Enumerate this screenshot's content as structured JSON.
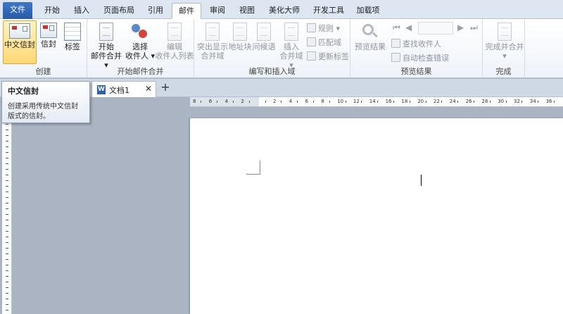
{
  "tabs": [
    {
      "label": "文件",
      "name": "tab-file"
    },
    {
      "label": "开始",
      "name": "tab-home"
    },
    {
      "label": "插入",
      "name": "tab-insert"
    },
    {
      "label": "页面布局",
      "name": "tab-page-layout"
    },
    {
      "label": "引用",
      "name": "tab-references"
    },
    {
      "label": "邮件",
      "name": "tab-mailings"
    },
    {
      "label": "审阅",
      "name": "tab-review"
    },
    {
      "label": "视图",
      "name": "tab-view"
    },
    {
      "label": "美化大师",
      "name": "tab-beautify"
    },
    {
      "label": "开发工具",
      "name": "tab-developer"
    },
    {
      "label": "加载项",
      "name": "tab-addins"
    }
  ],
  "ribbon": {
    "create": {
      "label": "创建",
      "chinese_envelope": "中文信封",
      "envelope": "信封",
      "labels": "标签"
    },
    "start_merge": {
      "label": "开始邮件合并",
      "start_line1": "开始",
      "start_line2": "邮件合并",
      "select_line1": "选择",
      "select_line2": "收件人",
      "edit_line1": "编辑",
      "edit_line2": "收件人列表"
    },
    "write_insert": {
      "label": "编写和插入域",
      "highlight_line1": "突出显示",
      "highlight_line2": "合并域",
      "address_block": "地址块",
      "greeting_line": "问候语",
      "insert_line1": "插入",
      "insert_line2": "合并域",
      "rules": "规则",
      "match_fields": "匹配域",
      "update_labels": "更新标签"
    },
    "preview": {
      "label": "预览结果",
      "preview_results": "预览结果",
      "find_recipient": "查找收件人",
      "auto_check": "自动检查错误"
    },
    "finish": {
      "label": "完成",
      "finish_merge": "完成并合并"
    }
  },
  "document_tab": {
    "title": "文档1",
    "close": "✕",
    "new": "+"
  },
  "ruler": {
    "labels": [
      "8",
      "6",
      "4",
      "2",
      "",
      "2",
      "4",
      "6",
      "8",
      "10",
      "12",
      "14",
      "16",
      "18",
      "20",
      "22",
      "24",
      "26",
      "28",
      "30",
      "32",
      "34",
      "36"
    ]
  },
  "tooltip": {
    "title": "中文信封",
    "body": "创建采用传统中文信封版式的信封。"
  }
}
